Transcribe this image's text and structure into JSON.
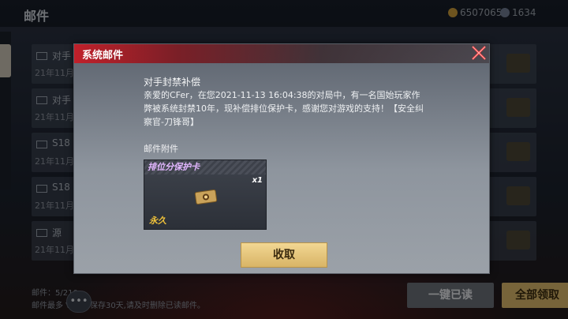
{
  "app": {
    "page_title": "邮件",
    "gp_amount": "6507065",
    "cf_amount": "1634"
  },
  "mail_list": [
    {
      "title": "对手",
      "date": "21年11月"
    },
    {
      "title": "对手",
      "date": "21年11月"
    },
    {
      "title": "S18",
      "date": "21年11月"
    },
    {
      "title": "S18",
      "date": "21年11月"
    },
    {
      "title": "源",
      "date": "21年11月"
    }
  ],
  "footer": {
    "count": "邮件：5/210",
    "notice": "邮件最多        VB)封,保存30天,请及时删除已读邮件。"
  },
  "buttons": {
    "read_all": "一键已读",
    "claim_all": "全部领取"
  },
  "dialog": {
    "title": "系统邮件",
    "subject": "对手封禁补偿",
    "body": "亲爱的CFer，在您2021-11-13 16:04:38的对局中，有一名国始玩家作弊被系统封禁10年，现补偿排位保护卡，感谢您对游戏的支持！【安全纠察官-刀锋哥】",
    "attachment_label": "邮件附件",
    "attachment": {
      "name": "排位分保护卡",
      "quantity": "x1",
      "duration": "永久"
    },
    "claim_label": "收取"
  },
  "colors": {
    "header_red": "#c0202a",
    "gold_button": "#d8b466",
    "attachment_name": "#e2b6ff",
    "permanent_tag": "#f0c23a"
  },
  "icons": [
    "envelope-icon",
    "close-icon",
    "chat-icon",
    "gp-coin-icon",
    "cf-point-icon",
    "protection-card-icon"
  ]
}
